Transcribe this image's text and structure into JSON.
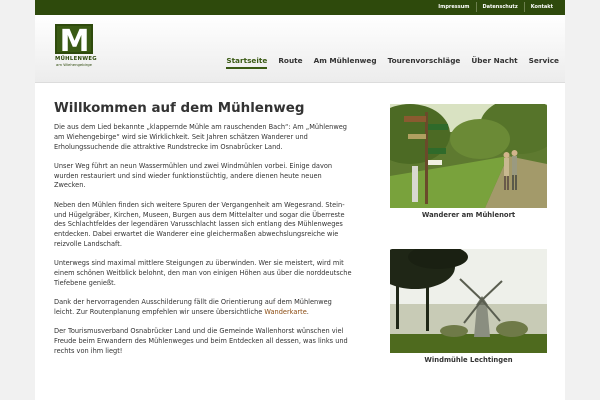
{
  "top_links": [
    "Impressum",
    "Datenschutz",
    "Kontakt"
  ],
  "logo": {
    "letter": "M",
    "name": "MÜHLENWEG",
    "sub": "am Wiehengebirge"
  },
  "nav": [
    "Startseite",
    "Route",
    "Am Mühlenweg",
    "Tourenvorschläge",
    "Über Nacht",
    "Service"
  ],
  "nav_active": "Startseite",
  "main": {
    "title": "Willkommen auf dem Mühlenweg",
    "paragraphs": [
      "Die aus dem Lied bekannte „klappernde Mühle am rauschenden Bach“: Am „Mühlenweg am Wiehengebirge“ wird sie Wirklichkeit. Seit Jahren schätzen Wanderer und Erholungssuchende die attraktive Rundstrecke im Osnabrücker Land.",
      "Unser Weg führt an neun Wassermühlen und zwei Windmühlen vorbei. Einige davon wurden restauriert und sind wieder funktionstüchtig, andere dienen heute neuen Zwecken.",
      "Neben den Mühlen finden sich weitere Spuren der Vergangenheit am Wegesrand. Stein- und Hügelgräber, Kirchen, Museen, Burgen aus dem Mittelalter und sogar die Überreste des Schlachtfeldes der legendären Varusschlacht lassen sich entlang des Mühlenweges entdecken. Dabei erwartet die Wanderer eine gleichermaßen abwechslungsreiche wie reizvolle Landschaft.",
      "Unterwegs sind maximal mittlere Steigungen zu überwinden. Wer sie meistert, wird mit einem schönen Weitblick belohnt, den man von einigen Höhen aus über die norddeutsche Tiefebene genießt."
    ],
    "p5_before": "Dank der hervorragenden Ausschilderung fällt die Orientierung auf dem Mühlenweg leicht. Zur Routenplanung empfehlen wir unsere übersichtliche ",
    "p5_link": "Wanderkarte",
    "p5_after": ".",
    "p6": "Der Tourismusverband Osnabrücker Land und die Gemeinde Wallenhorst wünschen viel Freude beim Erwandern des Mühlenweges und beim Entdecken all dessen, was links und rechts von ihm liegt!"
  },
  "images": [
    {
      "caption": "Wanderer am Mühlenort"
    },
    {
      "caption": "Windmühle Lechtingen"
    }
  ],
  "colors": {
    "brand_green": "#2e4a0c",
    "link": "#8a4a0f"
  }
}
